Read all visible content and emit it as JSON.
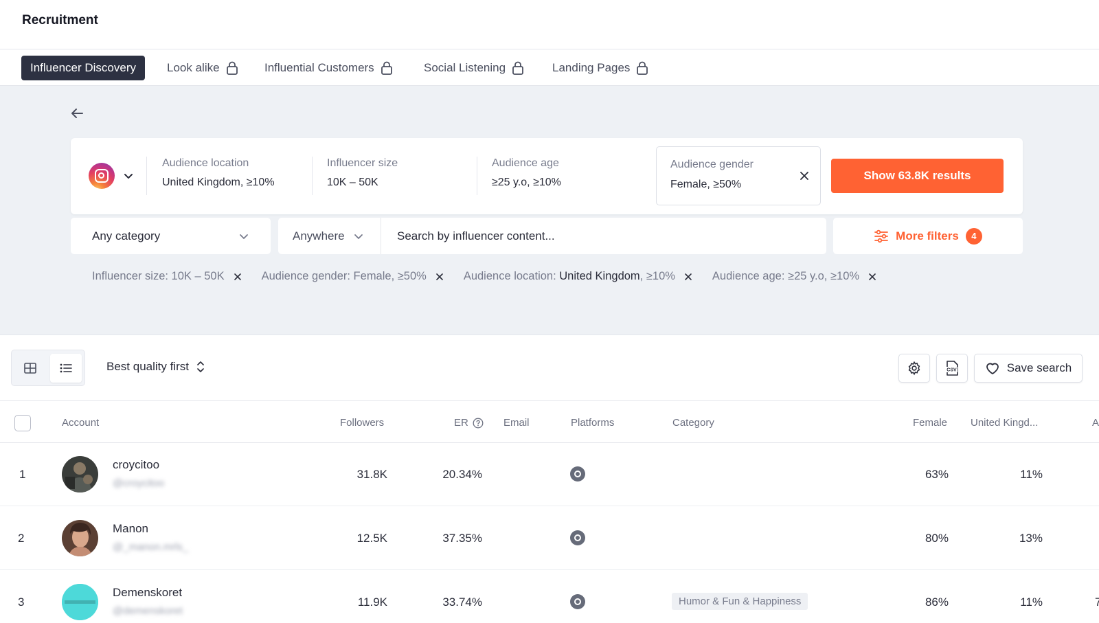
{
  "app": {
    "title": "Recruitment"
  },
  "tabs": [
    {
      "label": "Influencer Discovery",
      "active": true,
      "locked": false
    },
    {
      "label": "Look alike",
      "active": false,
      "locked": true
    },
    {
      "label": "Influential Customers",
      "active": false,
      "locked": true
    },
    {
      "label": "Social Listening",
      "active": false,
      "locked": true
    },
    {
      "label": "Landing Pages",
      "active": false,
      "locked": true
    }
  ],
  "filters": {
    "platform_icon": "instagram-icon",
    "audience_location": {
      "label": "Audience location",
      "value": "United Kingdom, ≥10%"
    },
    "influencer_size": {
      "label": "Influencer size",
      "value": "10K – 50K"
    },
    "audience_age": {
      "label": "Audience age",
      "value": "≥25 y.o, ≥10%"
    },
    "audience_gender": {
      "label": "Audience gender",
      "value": "Female, ≥50%"
    },
    "show_results": "Show 63.8K results"
  },
  "search": {
    "category": "Any category",
    "location": "Anywhere",
    "placeholder": "Search by influencer content...",
    "more_filters": "More filters",
    "more_filters_count": "4"
  },
  "chips": [
    {
      "label": "Influencer size: 10K – 50K"
    },
    {
      "label": "Audience gender: Female, ≥50%"
    },
    {
      "prefix": "Audience location: ",
      "strong": "United Kingdom",
      "suffix": ", ≥10%"
    },
    {
      "label": "Audience age: ≥25 y.o, ≥10%"
    }
  ],
  "toolbar": {
    "sort": "Best quality first",
    "save_search": "Save search",
    "csv": "CSV"
  },
  "table": {
    "headers": {
      "account": "Account",
      "followers": "Followers",
      "er": "ER",
      "email": "Email",
      "platforms": "Platforms",
      "category": "Category",
      "female": "Female",
      "uk": "United Kingd...",
      "extra": "A"
    },
    "rows": [
      {
        "index": "1",
        "name": "croycitoo",
        "handle": "@croycitoo",
        "followers": "31.8K",
        "er": "20.34%",
        "category": "",
        "female": "63%",
        "uk": "11%",
        "extra": ""
      },
      {
        "index": "2",
        "name": "Manon",
        "handle": "@_manon.mrls_",
        "followers": "12.5K",
        "er": "37.35%",
        "category": "",
        "female": "80%",
        "uk": "13%",
        "extra": ""
      },
      {
        "index": "3",
        "name": "Demenskoret",
        "handle": "@demenskoret",
        "followers": "11.9K",
        "er": "33.74%",
        "category": "Humor & Fun & Happiness",
        "female": "86%",
        "uk": "11%",
        "extra": "7"
      }
    ]
  },
  "colors": {
    "accent": "#ff6233",
    "active_tab": "#2d3142",
    "filter_bg": "#eef1f5",
    "avatar_3": "#4dd9d9"
  }
}
